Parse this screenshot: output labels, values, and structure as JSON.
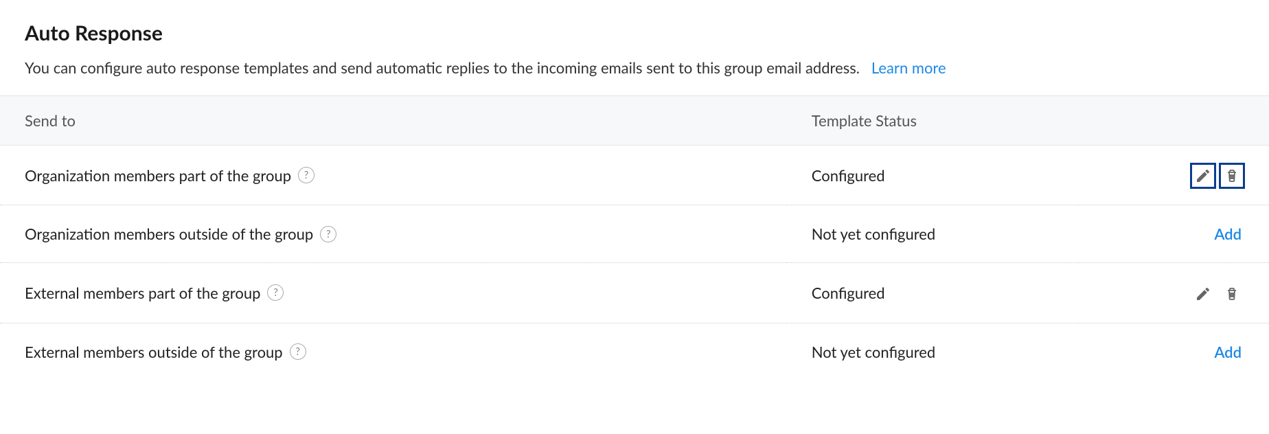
{
  "page": {
    "title": "Auto Response",
    "subtitle": "You can configure auto response templates and send automatic replies to the incoming emails sent to this group email address.",
    "learn_more": "Learn more"
  },
  "columns": {
    "send_to": "Send to",
    "template_status": "Template Status"
  },
  "help_glyph": "?",
  "actions": {
    "add": "Add"
  },
  "rows": [
    {
      "send_to": "Organization members part of the group",
      "status": "Configured",
      "configured": true,
      "highlighted": true
    },
    {
      "send_to": "Organization members outside of the group",
      "status": "Not yet configured",
      "configured": false,
      "highlighted": false
    },
    {
      "send_to": "External members part of the group",
      "status": "Configured",
      "configured": true,
      "highlighted": false
    },
    {
      "send_to": "External members outside of the group",
      "status": "Not yet configured",
      "configured": false,
      "highlighted": false
    }
  ]
}
